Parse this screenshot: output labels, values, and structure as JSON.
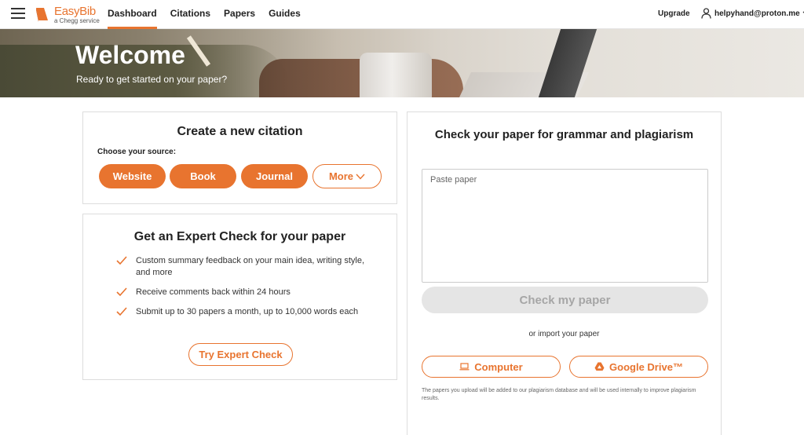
{
  "brand": {
    "name": "EasyBib",
    "tagline": "a Chegg service",
    "accent": "#e8742f"
  },
  "nav": {
    "links": [
      {
        "label": "Dashboard",
        "active": true
      },
      {
        "label": "Citations",
        "active": false
      },
      {
        "label": "Papers",
        "active": false
      },
      {
        "label": "Guides",
        "active": false
      }
    ],
    "upgrade": "Upgrade",
    "account_email": "helpyhand@proton.me",
    "icons": [
      "hamburger-menu-icon",
      "user-icon",
      "chevron-down-icon"
    ]
  },
  "hero": {
    "title": "Welcome",
    "subtitle": "Ready to get started on your paper?"
  },
  "citation": {
    "title": "Create a new citation",
    "choose_label": "Choose your source:",
    "sources": [
      "Website",
      "Book",
      "Journal"
    ],
    "more_label": "More"
  },
  "expert": {
    "title": "Get an Expert Check for your paper",
    "items": [
      "Custom summary feedback on your main idea, writing style, and more",
      "Receive comments back within 24 hours",
      "Submit up to 30 papers a month, up to 10,000 words each"
    ],
    "button": "Try Expert Check"
  },
  "check": {
    "title": "Check your paper for grammar and plagiarism",
    "paste_placeholder": "Paste paper",
    "check_button": "Check my paper",
    "import_text": "or import your paper",
    "computer_button": "Computer",
    "drive_button": "Google Drive™",
    "disclaimer": "The papers you upload will be added to our plagiarism database and will be used internally to improve plagiarism results."
  }
}
